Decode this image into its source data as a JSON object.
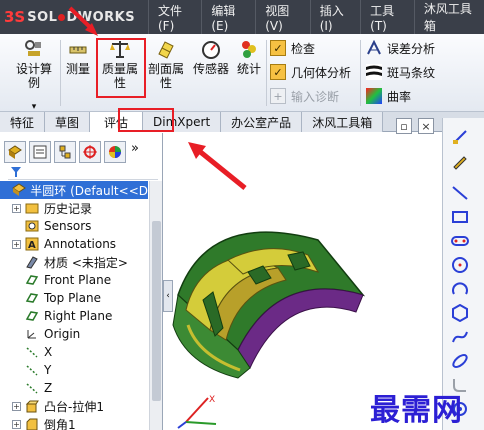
{
  "app": {
    "logo_prefix": "3S",
    "logo_text_before_dot": "SOL",
    "logo_text_after_dot": "DWORKS"
  },
  "menu": [
    "文件(F)",
    "编辑(E)",
    "视图(V)",
    "插入(I)",
    "工具(T)",
    "沐风工具箱"
  ],
  "ribbon": {
    "design_calc": "设计算例",
    "measure": "测量",
    "mass_props_line1": "质量属",
    "mass_props_line2": "性",
    "section_props_line1": "剖面属",
    "section_props_line2": "性",
    "sensors": "传感器",
    "stats": "统计",
    "check": "检查",
    "geometry_analysis": "几何体分析",
    "import_diagnose": "输入诊断",
    "deviation_analysis": "误差分析",
    "zebra": "斑马条纹",
    "curvature": "曲率"
  },
  "tabs": [
    "特征",
    "草图",
    "评估",
    "DimXpert",
    "办公室产品",
    "沐风工具箱"
  ],
  "tree": [
    {
      "label": "半圆环  (Default<<D",
      "expander": "",
      "selected": true
    },
    {
      "label": "历史记录",
      "expander": "+"
    },
    {
      "label": "Sensors",
      "expander": ""
    },
    {
      "label": "Annotations",
      "expander": "+"
    },
    {
      "label": "材质 <未指定>",
      "expander": ""
    },
    {
      "label": "Front Plane",
      "expander": ""
    },
    {
      "label": "Top Plane",
      "expander": ""
    },
    {
      "label": "Right Plane",
      "expander": ""
    },
    {
      "label": "Origin",
      "expander": ""
    },
    {
      "label": "X",
      "expander": ""
    },
    {
      "label": "Y",
      "expander": ""
    },
    {
      "label": "Z",
      "expander": ""
    },
    {
      "label": "凸台-拉伸1",
      "expander": "+"
    },
    {
      "label": "倒角1",
      "expander": "+"
    }
  ],
  "splitter_glyph": "‹",
  "view_controls": [
    "▫",
    "×"
  ],
  "panel_more": "»",
  "watermark": "最需网",
  "colors": {
    "highlight": "#e81e26",
    "part_green": "#2f8a2f",
    "part_purple": "#6b2a86",
    "part_yellow": "#d4cc3a"
  }
}
